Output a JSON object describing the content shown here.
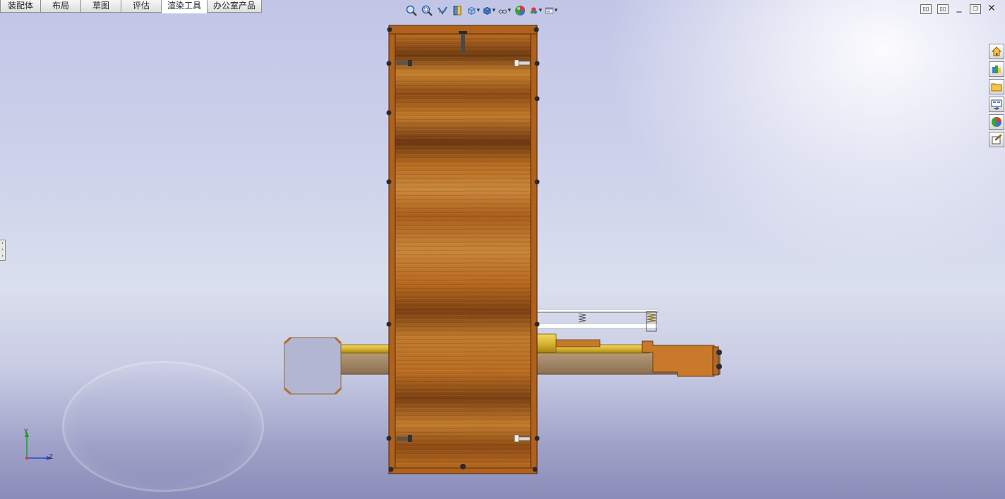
{
  "tabs": [
    {
      "label": "装配体",
      "active": false
    },
    {
      "label": "布局",
      "active": false
    },
    {
      "label": "草图",
      "active": false
    },
    {
      "label": "评估",
      "active": false
    },
    {
      "label": "渲染工具",
      "active": true
    },
    {
      "label": "办公室产品",
      "active": false
    }
  ],
  "hud_tools": [
    "zoom-to-fit-icon",
    "zoom-area-icon",
    "previous-view-icon",
    "section-view-icon",
    "view-orientation-icon",
    "display-style-icon",
    "hide-show-icon",
    "edit-appearance-icon",
    "apply-scene-icon",
    "view-settings-icon"
  ],
  "task_pane": [
    "home-icon",
    "design-library-icon",
    "file-explorer-icon",
    "view-palette-icon",
    "appearances-icon",
    "custom-properties-icon"
  ],
  "axes": {
    "y": "Y",
    "z": "Z"
  },
  "colors": {
    "wood": "#b86c22",
    "brass": "#d8b531",
    "steel": "#b3b6d3"
  }
}
